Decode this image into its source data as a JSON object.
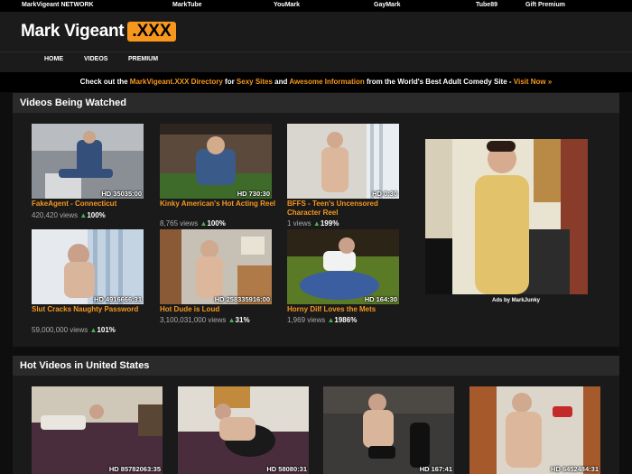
{
  "network": {
    "brand": "MarkVigeant NETWORK",
    "links": [
      "MarkTube",
      "YouMark",
      "GayMark",
      "Tube89",
      "Gift Premium"
    ]
  },
  "header": {
    "logo_text": "Mark Vigeant",
    "logo_badge": ".XXX"
  },
  "nav": {
    "items": [
      "HOME",
      "VIDEOS",
      "PREMIUM"
    ]
  },
  "promo": {
    "t1": "Check out the ",
    "l1": "MarkVigeant.XXX Directory",
    "t2": " for ",
    "l2": "Sexy Sites",
    "t3": " and ",
    "l3": "Awesome Information",
    "t4": " from the World's Best Adult Comedy Site - ",
    "l4": "Visit Now »"
  },
  "watched": {
    "heading": "Videos Being Watched",
    "videos": [
      {
        "title": "FakeAgent - Connecticut",
        "duration": "HD  35035:00",
        "views": "420,420 views",
        "rating": "100%"
      },
      {
        "title": "Kinky American's Hot Acting Reel",
        "duration": "HD  730:30",
        "views": "8,765 views",
        "rating": "100%"
      },
      {
        "title": "BFFS - Teen's Uncensored Character Reel",
        "duration": "HD  0:30",
        "views": "1 views",
        "rating": "199%"
      },
      {
        "title": "Slut Cracks Naughty Password",
        "duration": "HD  4916666:31",
        "views": "59,000,000 views",
        "rating": "101%"
      },
      {
        "title": "Hot Dude is Loud",
        "duration": "HD  258335916:00",
        "views": "3,100,031,000 views",
        "rating": "31%"
      },
      {
        "title": "Horny Dilf Loves the Mets",
        "duration": "HD  164:30",
        "views": "1,969 views",
        "rating": "1986%"
      }
    ],
    "ad_caption": "Ads by MarkJunky"
  },
  "hot": {
    "heading": "Hot Videos in United States",
    "videos": [
      {
        "duration": "HD  85782063:35"
      },
      {
        "duration": "HD  58080:31"
      },
      {
        "duration": "HD  167:41"
      },
      {
        "duration": "HD  6452484:31"
      }
    ]
  },
  "colors": {
    "accent": "#f7971e",
    "rating": "#4caf50",
    "panel": "#1a1a1a"
  }
}
